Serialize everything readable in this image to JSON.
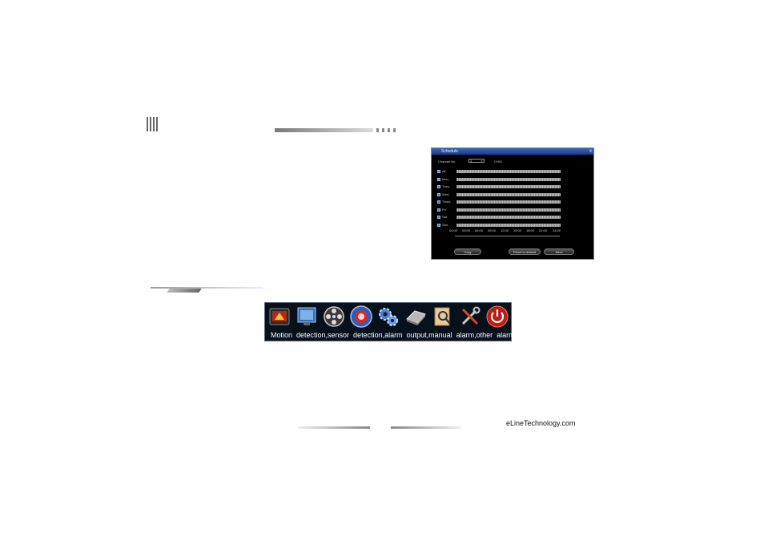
{
  "schedule": {
    "title": "Schedule",
    "close_glyph": "x",
    "channel_label": "Channel No.",
    "channel_value": "1",
    "channel_name": "CH01",
    "days": [
      {
        "label": "All",
        "checked": true
      },
      {
        "label": "Mon.",
        "checked": true
      },
      {
        "label": "Tues.",
        "checked": true
      },
      {
        "label": "Wed.",
        "checked": true
      },
      {
        "label": "Thurs.",
        "checked": true
      },
      {
        "label": "Fri.",
        "checked": true
      },
      {
        "label": "Sat.",
        "checked": true
      },
      {
        "label": "Sun.",
        "checked": true
      }
    ],
    "time_ticks": [
      "00:00",
      "03:00",
      "06:00",
      "09:00",
      "12:00",
      "15:00",
      "18:00",
      "21:00",
      "24:00"
    ],
    "buttons": {
      "copy": "Copy",
      "reset": "Reset to default",
      "save": "Save"
    },
    "accent": "#2a55b0"
  },
  "toolbar": {
    "icons": [
      "monitor-icon",
      "display-icon",
      "film-reel-icon",
      "alarm-icon",
      "network-gears-icon",
      "hard-disk-icon",
      "search-document-icon",
      "tools-icon",
      "power-icon"
    ],
    "caption": "Motion  detection,sensor  detection,alarm  output,manual  alarm,other  alarm!"
  },
  "footer": {
    "site": "eLineTechnology.com"
  }
}
